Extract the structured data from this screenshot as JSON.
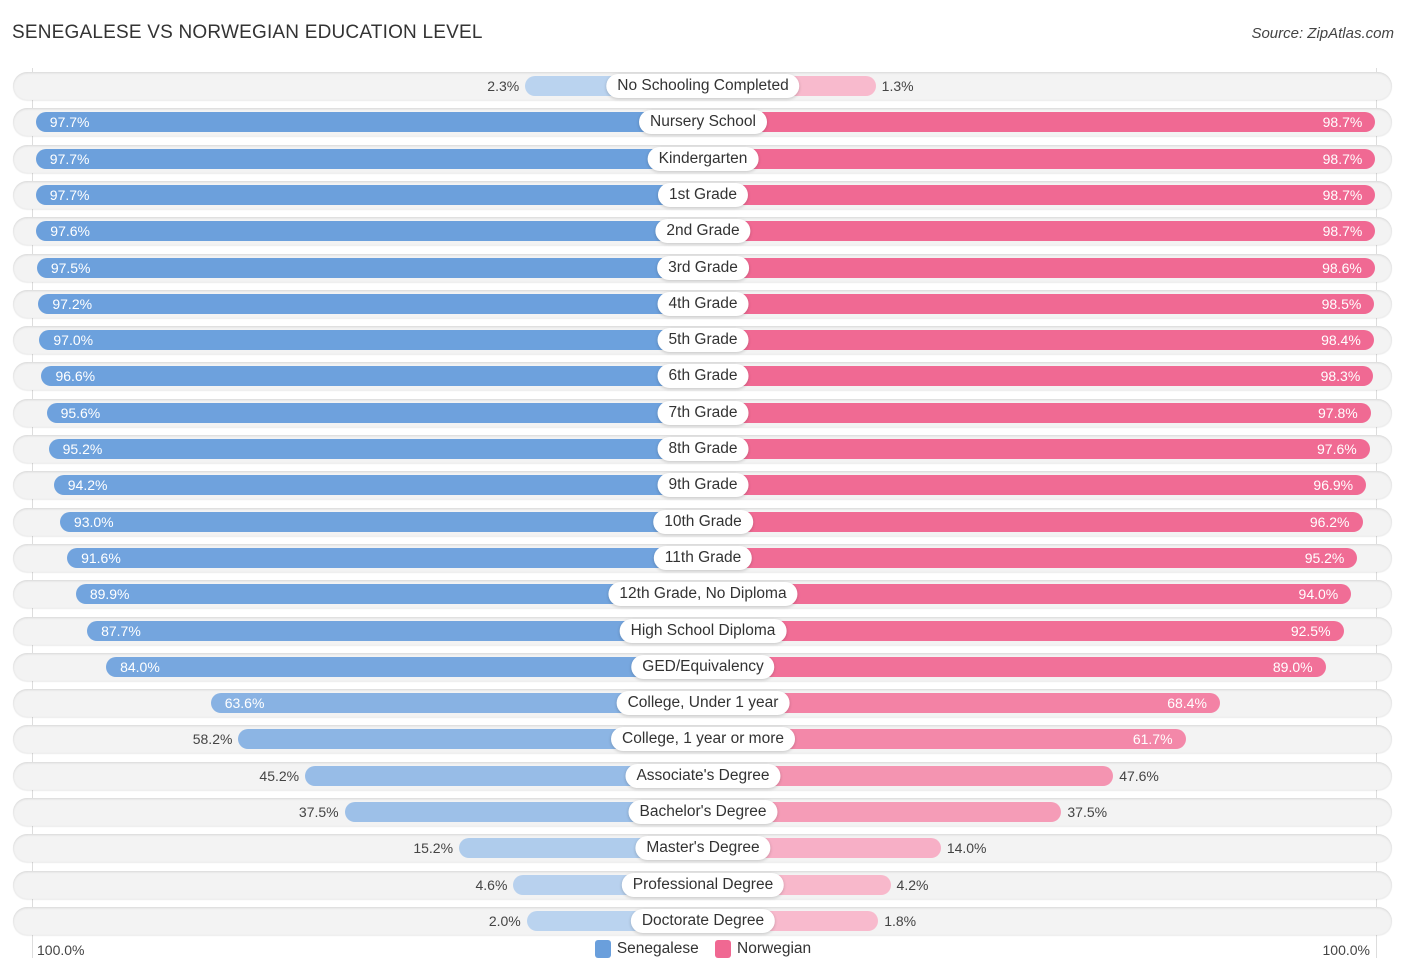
{
  "title": "SENEGALESE VS NORWEGIAN EDUCATION LEVEL",
  "source": "Source: ZipAtlas.com",
  "chart_data": {
    "type": "bar",
    "orientation": "horizontal-diverging",
    "title": "SENEGALESE VS NORWEGIAN EDUCATION LEVEL",
    "categories": [
      "No Schooling Completed",
      "Nursery School",
      "Kindergarten",
      "1st Grade",
      "2nd Grade",
      "3rd Grade",
      "4th Grade",
      "5th Grade",
      "6th Grade",
      "7th Grade",
      "8th Grade",
      "9th Grade",
      "10th Grade",
      "11th Grade",
      "12th Grade, No Diploma",
      "High School Diploma",
      "GED/Equivalency",
      "College, Under 1 year",
      "College, 1 year or more",
      "Associate's Degree",
      "Bachelor's Degree",
      "Master's Degree",
      "Professional Degree",
      "Doctorate Degree"
    ],
    "series": [
      {
        "name": "Senegalese",
        "color": "#6a9fdc",
        "values": [
          2.3,
          97.7,
          97.7,
          97.7,
          97.6,
          97.5,
          97.2,
          97.0,
          96.6,
          95.6,
          95.2,
          94.2,
          93.0,
          91.6,
          89.9,
          87.7,
          84.0,
          63.6,
          58.2,
          45.2,
          37.5,
          15.2,
          4.6,
          2.0
        ]
      },
      {
        "name": "Norwegian",
        "color": "#f06892",
        "values": [
          1.3,
          98.7,
          98.7,
          98.7,
          98.7,
          98.6,
          98.5,
          98.4,
          98.3,
          97.8,
          97.6,
          96.9,
          96.2,
          95.2,
          94.0,
          92.5,
          89.0,
          68.4,
          61.7,
          47.6,
          37.5,
          14.0,
          4.2,
          1.8
        ]
      }
    ],
    "value_suffix": "%",
    "axis_left_label": "100.0%",
    "axis_right_label": "100.0%",
    "xlim": [
      0,
      100
    ],
    "legend_position": "bottom-center",
    "grid": false
  }
}
